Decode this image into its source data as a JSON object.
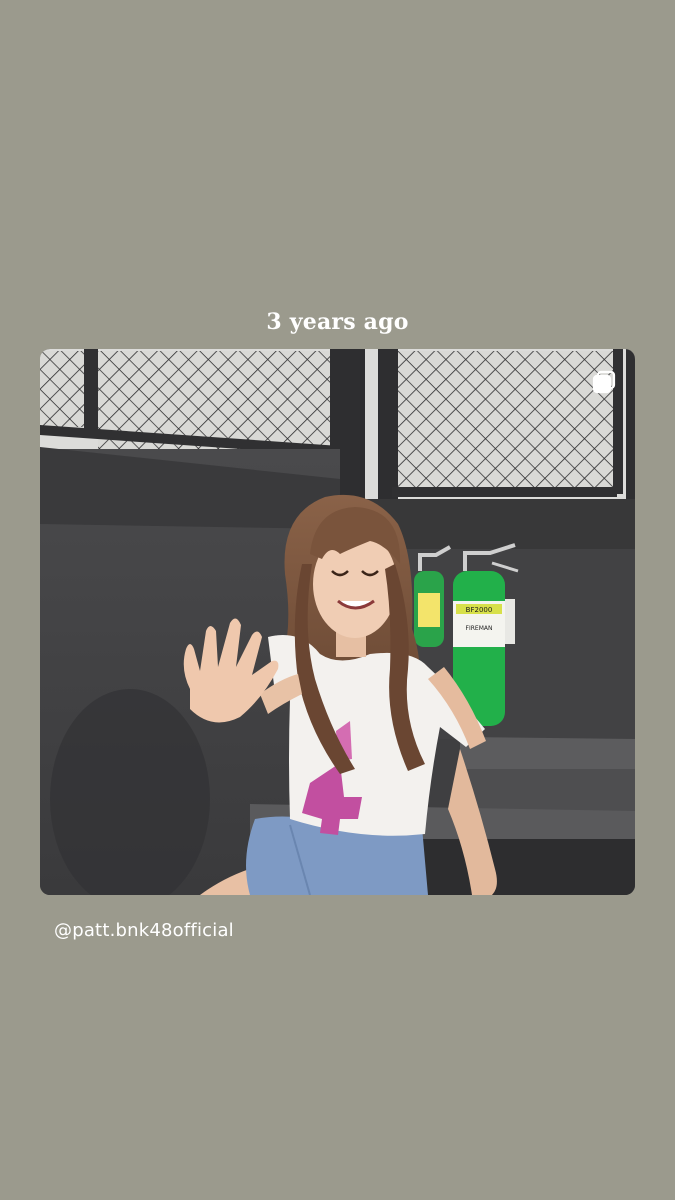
{
  "story": {
    "background_color": "#9b9a8d",
    "memory_label": "3 years ago",
    "username": "@patt.bnk48official",
    "photo": {
      "alt": "Girl smiling and waving, sitting on steps in front of fire extinguishers",
      "extinguisher_label_top": "BF2000",
      "extinguisher_label_brand": "FIREMAN"
    },
    "icons": {
      "multi_photo": "multiple-photos-icon"
    }
  }
}
